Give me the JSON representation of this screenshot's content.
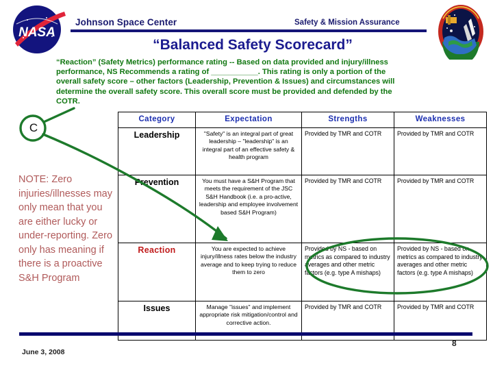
{
  "header": {
    "org_title": "Johnson Space Center",
    "dept_title": "Safety & Mission Assurance",
    "nasa_logo_alt": "NASA",
    "patch_logo_alt": "Mission Patch"
  },
  "slide": {
    "title": "“Balanced Safety Scorecard”",
    "intro_paragraph": "“Reaction” (Safety Metrics) performance rating --  Based on data provided and injury/illness performance,  NS Recommends a rating of ___________.   This rating is only a portion of the overall safety score – other factors (Leadership, Prevention & Issues) and circumstances will determine the overall safety score.   This overall score must be provided and defended by the COTR.",
    "annotation_letter": "C",
    "note": "NOTE:  Zero injuries/illnesses may only mean that you are either lucky or under-reporting.  Zero only has meaning if there is a proactive S&H Program"
  },
  "table": {
    "columns": [
      "Category",
      "Expectation",
      "Strengths",
      "Weaknesses"
    ],
    "rows": [
      {
        "category": "Leadership",
        "expectation": "\"Safety\" is an integral part of great leadership – \"leadership\" is an integral part of an effective safety & health program",
        "strengths": "Provided by TMR and COTR",
        "weaknesses": "Provided by TMR and COTR"
      },
      {
        "category": "Prevention",
        "expectation": "You must have a S&H Program that meets the requirement of the JSC S&H Handbook (i.e. a pro-active, leadership and employee involvement based S&H Program)",
        "strengths": "Provided by TMR and COTR",
        "weaknesses": "Provided by TMR and COTR"
      },
      {
        "category": "Reaction",
        "expectation": "You are expected to achieve injury/illness rates below the industry average and to keep trying to reduce them to zero",
        "strengths": "Provided by NS - based on metrics as compared to industry averages and other metric factors (e.g. type A mishaps)",
        "weaknesses": "Provided by NS - based on metrics as compared to industry averages and other metric factors (e.g. type A mishaps)"
      },
      {
        "category": "Issues",
        "expectation": "Manage \"issues\" and implement appropriate risk mitigation/control and corrective action.",
        "strengths": "Provided by TMR and COTR",
        "weaknesses": "Provided by TMR and COTR"
      }
    ]
  },
  "footer": {
    "date": "June 3, 2008",
    "page_number": "8"
  },
  "colors": {
    "navy": "#1b1b6f",
    "title_blue": "#1b1b8f",
    "header_blue": "#1c2fb0",
    "green": "#117711",
    "annotation_green": "#1d7a2b",
    "note_red": "#b05a5a",
    "accent_red": "#c01b1b",
    "rule_navy": "#151577"
  }
}
